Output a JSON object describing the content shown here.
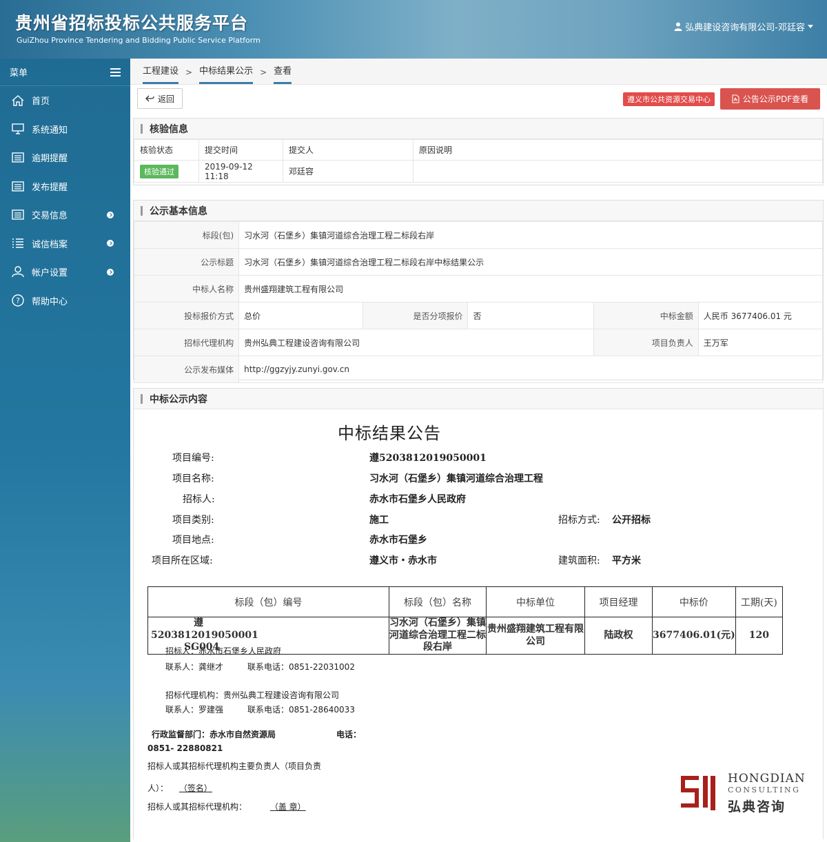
{
  "header": {
    "title": "贵州省招标投标公共服务平台",
    "subtitle": "GuiZhou Province Tendering and Bidding Public Service Platform",
    "user": "弘典建设咨询有限公司-邓廷容"
  },
  "sidebar": {
    "title": "菜单",
    "items": [
      {
        "label": "首页",
        "icon": "home-icon"
      },
      {
        "label": "系统通知",
        "icon": "monitor-icon"
      },
      {
        "label": "逾期提醒",
        "icon": "list-icon"
      },
      {
        "label": "发布提醒",
        "icon": "list-icon"
      },
      {
        "label": "交易信息",
        "icon": "list-icon"
      },
      {
        "label": "诚信档案",
        "icon": "list-icon"
      },
      {
        "label": "帐户设置",
        "icon": "user-icon"
      },
      {
        "label": "帮助中心",
        "icon": "help-icon"
      }
    ]
  },
  "breadcrumb": [
    "工程建设",
    "中标结果公示",
    "查看"
  ],
  "toolbar": {
    "back": "返回",
    "center": "遵义市公共资源交易中心",
    "pdf": "公告公示PDF查看"
  },
  "verify": {
    "title": "核验信息",
    "headers": [
      "核验状态",
      "提交时间",
      "提交人",
      "原因说明"
    ],
    "status": "核验通过",
    "time": "2019-09-12 11:18",
    "submitter": "邓廷容",
    "reason": ""
  },
  "basic": {
    "title": "公示基本信息",
    "section_label": "标段(包)",
    "section_value": "习水河（石堡乡）集镇河道综合治理工程二标段右岸",
    "notice_title_label": "公示标题",
    "notice_title_value": "习水河（石堡乡）集镇河道综合治理工程二标段右岸中标结果公示",
    "winner_label": "中标人名称",
    "winner_value": "贵州盛翔建筑工程有限公司",
    "quote_label": "投标报价方式",
    "quote_value": "总价",
    "split_label": "是否分项报价",
    "split_value": "否",
    "amount_label": "中标金额",
    "amount_value": "人民币 3677406.01 元",
    "agency_label": "招标代理机构",
    "agency_value": "贵州弘典工程建设咨询有限公司",
    "leader_label": "项目负责人",
    "leader_value": "王万军",
    "media_label": "公示发布媒体",
    "media_value": "http://ggzyjy.zunyi.gov.cn"
  },
  "content": {
    "title": "中标公示内容",
    "notice_title": "中标结果公告",
    "project_no_label": "项目编号:",
    "project_no": "遵5203812019050001",
    "project_name_label": "项目名称:",
    "project_name": "习水河（石堡乡）集镇河道综合治理工程",
    "tenderer_label": "招标人:",
    "tenderer": "赤水市石堡乡人民政府",
    "category_label": "项目类别:",
    "category": "施工",
    "method_label": "招标方式:",
    "method": "公开招标",
    "location_label": "项目地点:",
    "location": "赤水市石堡乡",
    "region_label": "项目所在区域:",
    "region": "遵义市・赤水市",
    "area_label": "建筑面积:",
    "area": "平方米",
    "table_headers": [
      "标段（包）编号",
      "标段（包）名称",
      "中标单位",
      "项目经理",
      "中标价",
      "工期(天)"
    ],
    "row": {
      "no_1": "遵",
      "no_2": "5203812019050001",
      "no_3": "SG004",
      "name": "习水河（石堡乡）集镇河道综合治理工程二标段右岸",
      "unit": "贵州盛翔建筑工程有限公司",
      "manager": "陆政权",
      "price": "3677406.01(元)",
      "days": "120"
    },
    "tenderer_line": "招标人：赤水市石堡乡人民政府",
    "contact1": "联系人：龚继才",
    "phone1": "联系电话：0851-22031002",
    "agency_line": "招标代理机构：贵州弘典工程建设咨询有限公司",
    "contact2": "联系人：罗建强",
    "phone2": "联系电话：0851-28640033",
    "supervisor": "行政监督部门：赤水市自然资源局",
    "phone_label": "电话：",
    "supervisor_phone": "0851- 22880821",
    "resp_line1": "招标人或其招标代理机构主要负责人（项目负责",
    "resp_line2_prefix": "人）：",
    "sign": "（签名）",
    "org_line_prefix": "招标人或其招标代理机构：",
    "seal": "（盖 章）"
  },
  "logo": {
    "en1": "HONGDIAN",
    "en2": "CONSULTING",
    "cn": "弘典咨询",
    "color": "#a8201a"
  }
}
